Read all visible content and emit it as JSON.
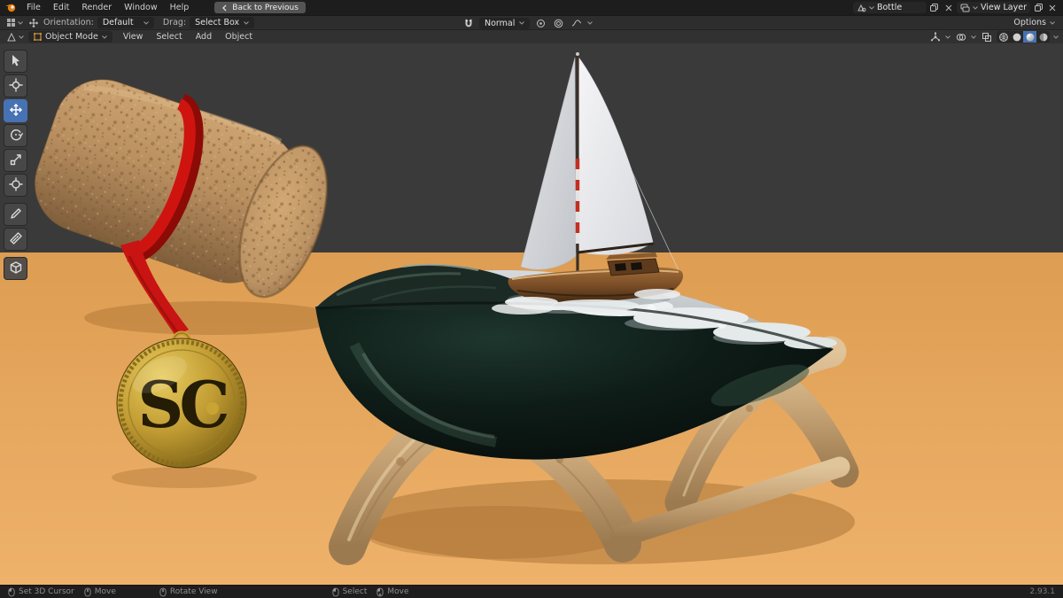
{
  "topbar": {
    "menus": [
      {
        "label": "File"
      },
      {
        "label": "Edit"
      },
      {
        "label": "Render"
      },
      {
        "label": "Window"
      },
      {
        "label": "Help"
      }
    ],
    "back_button": "Back to Previous",
    "scene_field": {
      "value": "Bottle"
    },
    "view_layer_field": {
      "value": "View Layer"
    }
  },
  "tool_settings": {
    "orientation_label": "Orientation:",
    "orientation_value": "Default",
    "drag_label": "Drag:",
    "drag_value": "Select Box",
    "snap_value": "Normal",
    "options_button": "Options"
  },
  "viewport_header": {
    "mode": "Object Mode",
    "menus": [
      {
        "label": "View"
      },
      {
        "label": "Select"
      },
      {
        "label": "Add"
      },
      {
        "label": "Object"
      }
    ]
  },
  "status_bar": {
    "hints": [
      {
        "label": "Set 3D Cursor"
      },
      {
        "label": "Move"
      },
      {
        "label": "Rotate View"
      },
      {
        "label": "Select"
      },
      {
        "label": "Move"
      }
    ],
    "version": "2.93.1"
  },
  "scene": {
    "medal_monogram": "SC",
    "objects": [
      {
        "name": "cork"
      },
      {
        "name": "ribbon"
      },
      {
        "name": "medal"
      },
      {
        "name": "display-stand"
      },
      {
        "name": "bottle-sea"
      },
      {
        "name": "sailing-ship"
      }
    ]
  },
  "colors": {
    "accent": "#4772b3",
    "topbar-bg": "#1d1d1d",
    "toolrow-bg": "#2d2d2d",
    "header-bg": "#313131",
    "world-bg": "#3b3b3b",
    "floor": "#e6a55c",
    "cork": "#bb9060",
    "ribbon": "#c81412",
    "medal-gold": "#bb9732",
    "wood": "#c9a97c",
    "water-dark": "#0d1b16",
    "foam": "#edf0f0",
    "sail": "#e9eaec",
    "hull": "#7c4f28"
  }
}
